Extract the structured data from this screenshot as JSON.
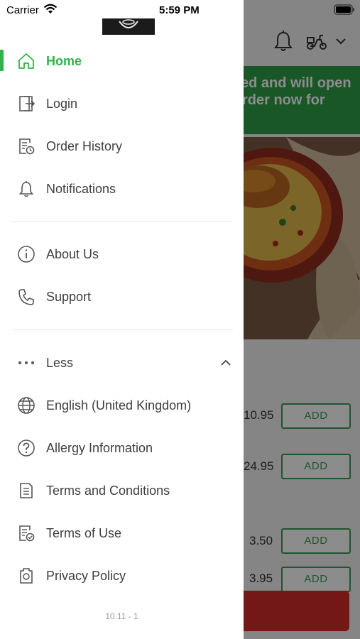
{
  "status_bar": {
    "carrier": "Carrier",
    "time": "5:59 PM",
    "wifi_icon": "wifi-icon",
    "battery_icon": "battery-icon"
  },
  "drawer": {
    "active_color": "#2fb34b",
    "menu_primary": [
      {
        "label": "Home",
        "icon": "home-icon",
        "active": true
      },
      {
        "label": "Login",
        "icon": "login-icon"
      },
      {
        "label": "Order History",
        "icon": "order-history-icon"
      },
      {
        "label": "Notifications",
        "icon": "bell-icon"
      }
    ],
    "menu_secondary": [
      {
        "label": "About Us",
        "icon": "info-icon"
      },
      {
        "label": "Support",
        "icon": "phone-icon"
      }
    ],
    "less_toggle": {
      "label": "Less",
      "icon": "more-dots-icon",
      "chevron": "chevron-up-icon"
    },
    "menu_more": [
      {
        "label": "English (United Kingdom)",
        "icon": "globe-icon"
      },
      {
        "label": "Allergy Information",
        "icon": "question-icon"
      },
      {
        "label": "Terms and Conditions",
        "icon": "document-icon"
      },
      {
        "label": "Terms of Use",
        "icon": "document-check-icon"
      },
      {
        "label": "Privacy Policy",
        "icon": "privacy-icon"
      }
    ],
    "version": "10.11 - 1"
  },
  "background": {
    "banner_line1": "ed and will open",
    "banner_line2": "rder now for",
    "banner_color": "#2e9e48",
    "items": [
      {
        "price": "10.95",
        "button": "ADD"
      },
      {
        "price": "24.95",
        "button": "ADD"
      },
      {
        "price": "3.50",
        "button": "ADD"
      },
      {
        "price": "3.95",
        "button": "ADD"
      }
    ],
    "cart_color": "#d42a2a"
  }
}
